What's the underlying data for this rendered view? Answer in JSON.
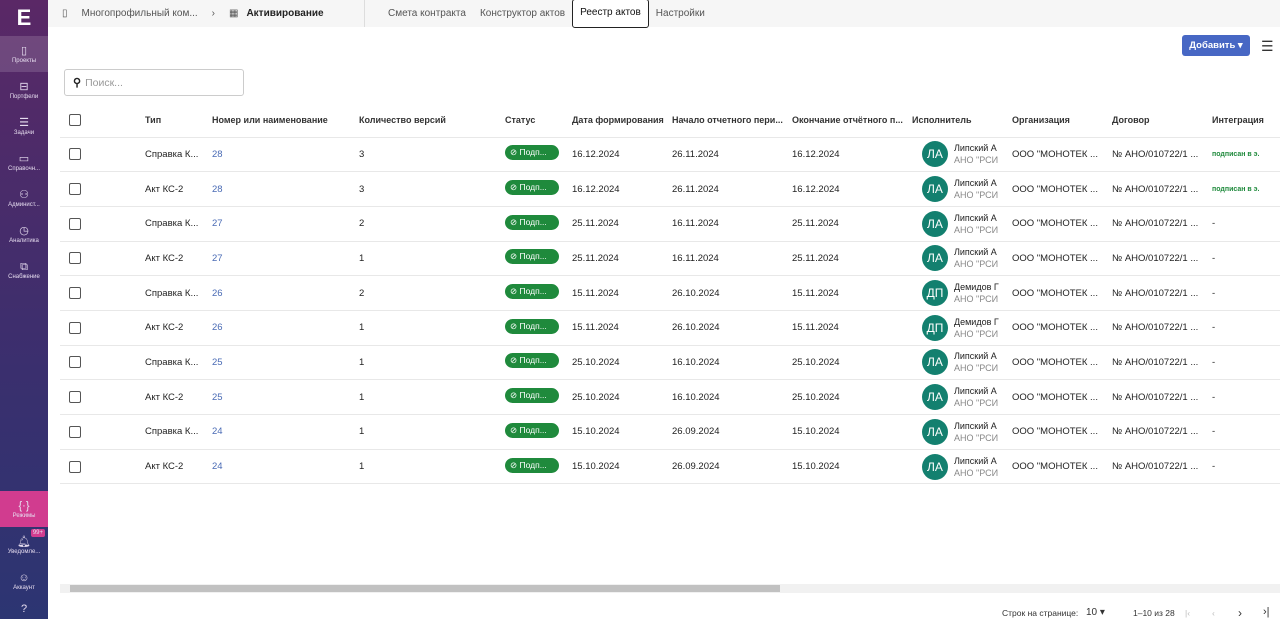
{
  "sidebar": {
    "logo": "E",
    "items": [
      {
        "label": "Проекты",
        "icon": "building-icon"
      },
      {
        "label": "Портфели",
        "icon": "briefcase-icon"
      },
      {
        "label": "Задачи",
        "icon": "tasks-icon"
      },
      {
        "label": "Справочн...",
        "icon": "book-icon"
      },
      {
        "label": "Админист...",
        "icon": "users-icon"
      },
      {
        "label": "Аналитика",
        "icon": "clock-icon"
      },
      {
        "label": "Снабжение",
        "icon": "supply-icon"
      }
    ],
    "mode": "Режимы",
    "notifications": "Уведомле...",
    "notif_badge": "99+",
    "account": "Аккаунт"
  },
  "breadcrumb": {
    "project": "Многопрофильный ком...",
    "section": "Активирование"
  },
  "tabs": [
    "Смета контракта",
    "Конструктор актов",
    "Реестр актов",
    "Настройки"
  ],
  "active_tab": "Реестр актов",
  "toolbar": {
    "add_label": "Добавить ▾"
  },
  "search": {
    "placeholder": "Поиск..."
  },
  "table": {
    "columns": [
      "Тип",
      "Номер или наименование",
      "Количество версий",
      "Статус",
      "Дата формирования",
      "Начало отчетного пери...",
      "Окончание отчётного п...",
      "Исполнитель",
      "Организация",
      "Договор",
      "Интеграция"
    ],
    "rows": [
      [
        "Справка К...",
        "28",
        "3",
        "Подп...",
        "16.12.2024",
        "26.11.2024",
        "16.12.2024",
        "ЛА",
        "Липский А",
        "АНО \"РСИ",
        "ООО \"МОНОТЕК ...",
        "№ АНО/010722/1 ...",
        "подписан в э."
      ],
      [
        "Акт КС-2",
        "28",
        "3",
        "Подп...",
        "16.12.2024",
        "26.11.2024",
        "16.12.2024",
        "ЛА",
        "Липский А",
        "АНО \"РСИ",
        "ООО \"МОНОТЕК ...",
        "№ АНО/010722/1 ...",
        "подписан в э."
      ],
      [
        "Справка К...",
        "27",
        "2",
        "Подп...",
        "25.11.2024",
        "16.11.2024",
        "25.11.2024",
        "ЛА",
        "Липский А",
        "АНО \"РСИ",
        "ООО \"МОНОТЕК ...",
        "№ АНО/010722/1 ...",
        "-"
      ],
      [
        "Акт КС-2",
        "27",
        "1",
        "Подп...",
        "25.11.2024",
        "16.11.2024",
        "25.11.2024",
        "ЛА",
        "Липский А",
        "АНО \"РСИ",
        "ООО \"МОНОТЕК ...",
        "№ АНО/010722/1 ...",
        "-"
      ],
      [
        "Справка К...",
        "26",
        "2",
        "Подп...",
        "15.11.2024",
        "26.10.2024",
        "15.11.2024",
        "ДП",
        "Демидов Г",
        "АНО \"РСИ",
        "ООО \"МОНОТЕК ...",
        "№ АНО/010722/1 ...",
        "-"
      ],
      [
        "Акт КС-2",
        "26",
        "1",
        "Подп...",
        "15.11.2024",
        "26.10.2024",
        "15.11.2024",
        "ДП",
        "Демидов Г",
        "АНО \"РСИ",
        "ООО \"МОНОТЕК ...",
        "№ АНО/010722/1 ...",
        "-"
      ],
      [
        "Справка К...",
        "25",
        "1",
        "Подп...",
        "25.10.2024",
        "16.10.2024",
        "25.10.2024",
        "ЛА",
        "Липский А",
        "АНО \"РСИ",
        "ООО \"МОНОТЕК ...",
        "№ АНО/010722/1 ...",
        "-"
      ],
      [
        "Акт КС-2",
        "25",
        "1",
        "Подп...",
        "25.10.2024",
        "16.10.2024",
        "25.10.2024",
        "ЛА",
        "Липский А",
        "АНО \"РСИ",
        "ООО \"МОНОТЕК ...",
        "№ АНО/010722/1 ...",
        "-"
      ],
      [
        "Справка К...",
        "24",
        "1",
        "Подп...",
        "15.10.2024",
        "26.09.2024",
        "15.10.2024",
        "ЛА",
        "Липский А",
        "АНО \"РСИ",
        "ООО \"МОНОТЕК ...",
        "№ АНО/010722/1 ...",
        "-"
      ],
      [
        "Акт КС-2",
        "24",
        "1",
        "Подп...",
        "15.10.2024",
        "26.09.2024",
        "15.10.2024",
        "ЛА",
        "Липский А",
        "АНО \"РСИ",
        "ООО \"МОНОТЕК ...",
        "№ АНО/010722/1 ...",
        "-"
      ]
    ]
  },
  "pagination": {
    "rows_label": "Строк на странице:",
    "rows_value": "10",
    "range": "1–10 из 28"
  },
  "colors": {
    "accent": "#4767c4",
    "status": "#1f8a3c",
    "avatar": "#13806f",
    "mode": "#d13c8f"
  }
}
